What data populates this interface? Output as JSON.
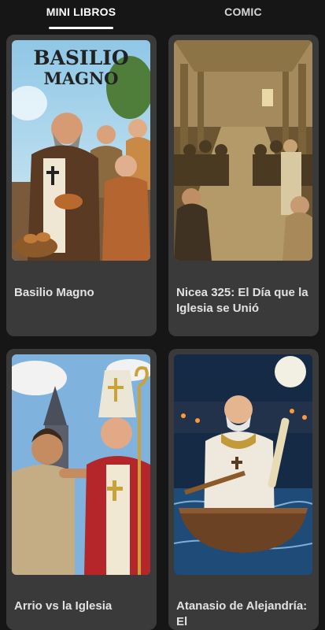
{
  "tabs": [
    {
      "label": "MINI LIBROS",
      "active": true
    },
    {
      "label": "COMIC",
      "active": false
    }
  ],
  "books": [
    {
      "title": "Basilio Magno",
      "cover_text": [
        "BASILIO",
        "MAGNO"
      ]
    },
    {
      "title": "Nicea 325: El Día que la Iglesia se Unió"
    },
    {
      "title": "Arrio vs la Iglesia"
    },
    {
      "title": "Atanasio de Alejandría: El"
    }
  ],
  "colors": {
    "background": "#161616",
    "card": "#3a3a3a",
    "accent": "#ffffff"
  }
}
